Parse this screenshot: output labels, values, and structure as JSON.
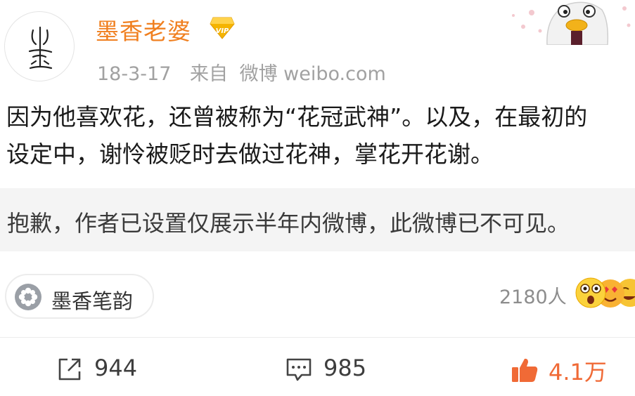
{
  "post": {
    "author": {
      "name": "墨香老婆",
      "vip_badge": "VIP",
      "avatar_icon": "hand-drawn-sketch-avatar"
    },
    "meta": {
      "date": "18-3-17",
      "source_prefix": "来自",
      "source_app": "微博 weibo.com"
    },
    "text_lines": [
      "因为他喜欢花，还曾被称为“花冠武神”。以及，在最初的",
      "设定中，谢怜被贬时去做过花神，掌花开花谢。"
    ],
    "notice": "抱歉，作者已设置仅展示半年内微博，此微博已不可见。",
    "topic": {
      "icon": "flower-icon",
      "label": "墨香笔韵"
    },
    "reactions": {
      "count_label": "2180人",
      "icons": [
        "shocked-emoji",
        "heart-eyes-emoji",
        "laughing-emoji"
      ]
    },
    "actions": {
      "share": {
        "icon": "share-icon",
        "count": "944"
      },
      "comment": {
        "icon": "comment-icon",
        "count": "985"
      },
      "like": {
        "icon": "thumbs-up-icon",
        "count": "4.1万"
      }
    }
  },
  "colors": {
    "username": "#f07f1f",
    "meta": "#a1a1a1",
    "notice_bg": "#f4f4f4",
    "like_accent": "#f06a36",
    "vip_gold": "#f5b400"
  }
}
